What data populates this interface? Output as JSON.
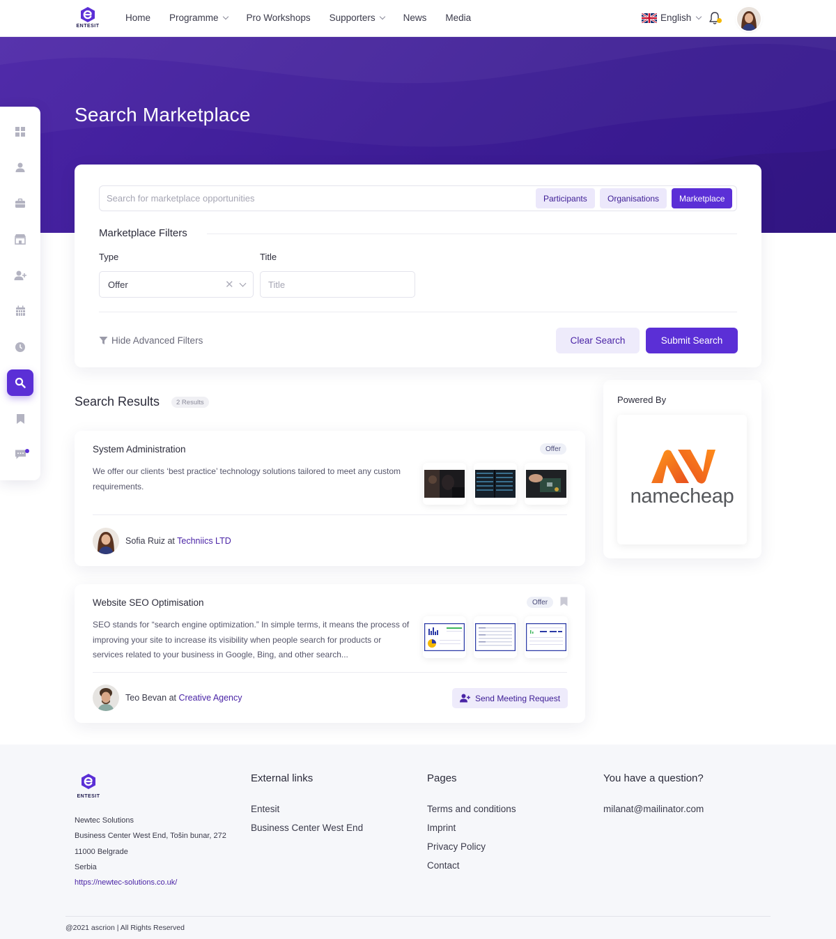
{
  "header": {
    "logo_text": "ENTESIT",
    "nav": [
      {
        "label": "Home",
        "dropdown": false
      },
      {
        "label": "Programme",
        "dropdown": true
      },
      {
        "label": "Pro Workshops",
        "dropdown": false
      },
      {
        "label": "Supporters",
        "dropdown": true
      },
      {
        "label": "News",
        "dropdown": false
      },
      {
        "label": "Media",
        "dropdown": false
      }
    ],
    "language": "English",
    "language_flag": "uk-flag-icon",
    "notification_dot_color": "#f5b800"
  },
  "hero": {
    "title": "Search Marketplace",
    "gradient": [
      "#4a24a6",
      "#34178a"
    ]
  },
  "sidebar": {
    "items": [
      {
        "icon": "dashboard-icon",
        "active": false
      },
      {
        "icon": "user-icon",
        "active": false
      },
      {
        "icon": "briefcase-icon",
        "active": false
      },
      {
        "icon": "store-icon",
        "active": false
      },
      {
        "icon": "add-user-icon",
        "active": false
      },
      {
        "icon": "calendar-icon",
        "active": false
      },
      {
        "icon": "clock-icon",
        "active": false
      },
      {
        "icon": "search-icon",
        "active": true
      },
      {
        "icon": "bookmark-icon",
        "active": false
      },
      {
        "icon": "chat-icon",
        "active": false,
        "has_notification": true
      }
    ],
    "accent": "#5b2fd6"
  },
  "search": {
    "placeholder": "Search for marketplace opportunities",
    "value": "",
    "segments": [
      {
        "label": "Participants",
        "active": false
      },
      {
        "label": "Organisations",
        "active": false
      },
      {
        "label": "Marketplace",
        "active": true
      }
    ],
    "filters_title": "Marketplace Filters",
    "type_label": "Type",
    "type_value": "Offer",
    "title_label": "Title",
    "title_placeholder": "Title",
    "title_value": "",
    "advanced_toggle": "Hide Advanced Filters",
    "clear_label": "Clear Search",
    "submit_label": "Submit Search"
  },
  "results": {
    "title": "Search Results",
    "count_label": "2 Results",
    "items": [
      {
        "title": "System Administration",
        "badge": "Offer",
        "description": "We offer our clients ‘best practice’ technology solutions tailored to meet any custom requirements.",
        "person": "Sofia Ruiz",
        "at": "at",
        "organisation": "Techniics LTD",
        "bookmark": false,
        "meeting_button": ""
      },
      {
        "title": "Website SEO Optimisation",
        "badge": "Offer",
        "description": "SEO stands for “search engine optimization.” In simple terms, it means the process of improving your site to increase its visibility when people search for products or services related to your business in Google, Bing, and other search...",
        "person": "Teo Bevan",
        "at": "at",
        "organisation": "Creative Agency",
        "bookmark": true,
        "meeting_button": "Send Meeting Request"
      }
    ]
  },
  "powered_by": {
    "label": "Powered By",
    "logo_text": "namecheap",
    "logo_colors": [
      "#ff8c00",
      "#de3723"
    ]
  },
  "footer": {
    "logo_text": "ENTESIT",
    "address": [
      "Newtec Solutions",
      "Business Center West End, Tošin bunar, 272",
      "11000 Belgrade",
      "Serbia"
    ],
    "website": "https://newtec-solutions.co.uk/",
    "columns": [
      {
        "heading": "External links",
        "links": [
          "Entesit",
          "Business Center West End"
        ]
      },
      {
        "heading": "Pages",
        "links": [
          "Terms and conditions",
          "Imprint",
          "Privacy Policy",
          "Contact"
        ]
      },
      {
        "heading": "You have a question?",
        "links": [
          "milanat@mailinator.com"
        ]
      }
    ],
    "copyright": "@2021 ascrion | All Rights Reserved"
  }
}
